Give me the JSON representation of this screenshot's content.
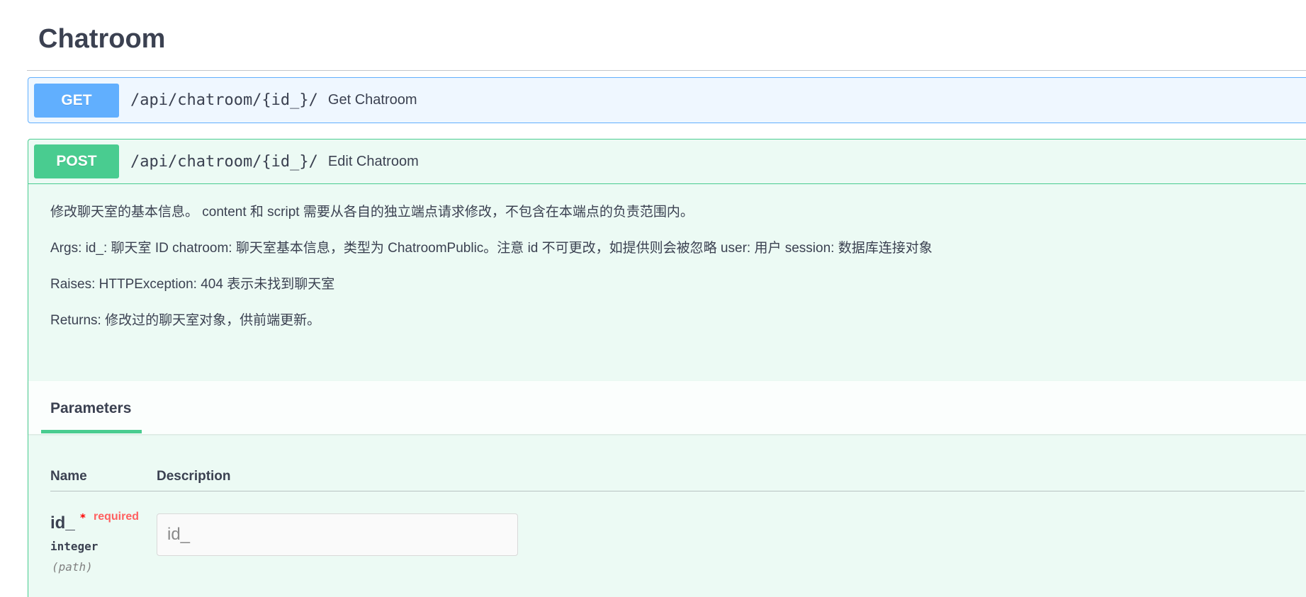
{
  "section": {
    "title": "Chatroom"
  },
  "operations": [
    {
      "method": "GET",
      "path": "/api/chatroom/{id_}/",
      "summary": "Get Chatroom"
    },
    {
      "method": "POST",
      "path": "/api/chatroom/{id_}/",
      "summary": "Edit Chatroom",
      "description": [
        "修改聊天室的基本信息。 content 和 script 需要从各自的独立端点请求修改，不包含在本端点的负责范围内。",
        "Args: id_: 聊天室 ID chatroom: 聊天室基本信息，类型为 ChatroomPublic。注意 id 不可更改，如提供则会被忽略 user: 用户 session: 数据库连接对象",
        "Raises: HTTPException: 404 表示未找到聊天室",
        "Returns: 修改过的聊天室对象，供前端更新。"
      ],
      "parameters_tab": "Parameters",
      "columns": {
        "name": "Name",
        "description": "Description"
      },
      "parameters": [
        {
          "name": "id_",
          "required_star": "*",
          "required_label": "required",
          "type": "integer",
          "in": "(path)",
          "placeholder": "id_"
        }
      ]
    }
  ],
  "colors": {
    "get": "#61affe",
    "post": "#49cc90",
    "text": "#3b4151",
    "required": "#ff6060"
  }
}
